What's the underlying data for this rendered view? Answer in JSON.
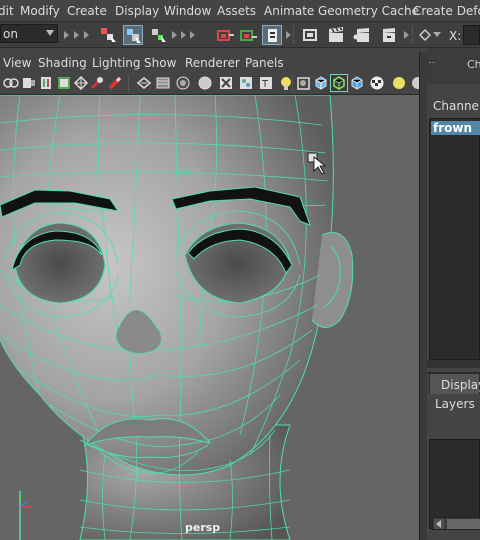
{
  "menubar": {
    "items": [
      "dit",
      "Modify",
      "Create",
      "Display",
      "Window",
      "Assets",
      "Animate",
      "Geometry Cache",
      "Create Deform"
    ]
  },
  "statusline": {
    "mode_value": "on",
    "x_label": "X:"
  },
  "panel": {
    "menu": [
      "View",
      "Shading",
      "Lighting",
      "Show",
      "Renderer",
      "Panels"
    ],
    "camera_label": "persp"
  },
  "channel_box": {
    "tab_label": "Ch",
    "channels_label": "Channels",
    "selected_node": "frown"
  },
  "layer_editor": {
    "tab_display": "Display",
    "layers_label": "Layers"
  },
  "colors": {
    "wireframe": "#4fe0a8",
    "selection": "#5285a6",
    "ui_bg": "#444444"
  }
}
